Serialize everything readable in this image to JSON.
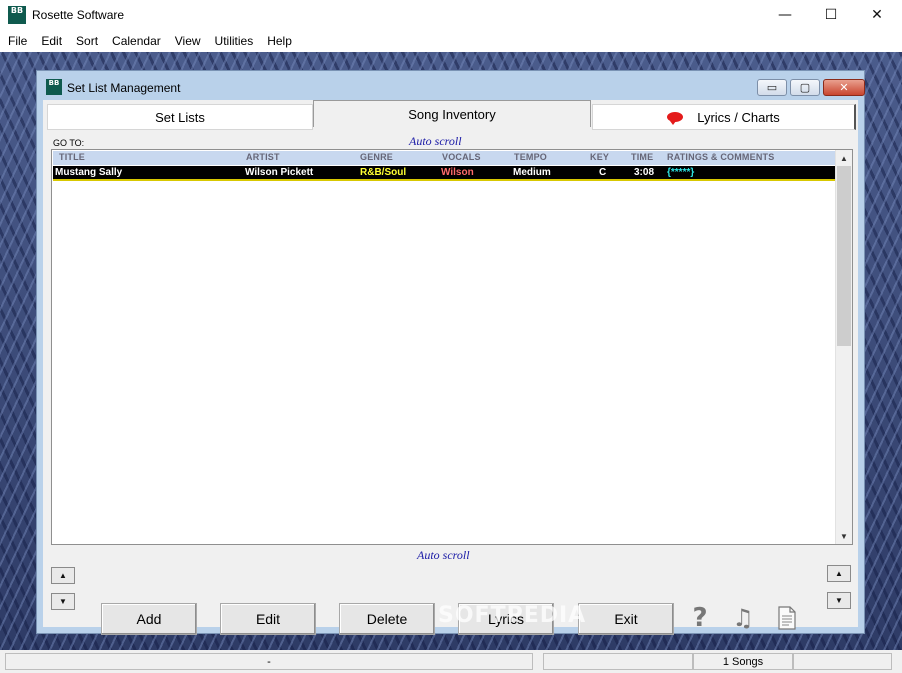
{
  "app": {
    "logo_text": "BB",
    "title": "Rosette Software",
    "controls": {
      "minimize": "—",
      "maximize": "☐",
      "close": "✕"
    }
  },
  "menu": [
    "File",
    "Edit",
    "Sort",
    "Calendar",
    "View",
    "Utilities",
    "Help"
  ],
  "dialog": {
    "title": "Set List Management",
    "controls": {
      "minimize": "▭",
      "maximize": "▢",
      "close": "✕"
    },
    "tabs": [
      {
        "label": "Set Lists",
        "active": false
      },
      {
        "label": "Song Inventory",
        "active": true
      },
      {
        "label": "Lyrics / Charts",
        "active": false,
        "icon": "speech-bubble-icon"
      }
    ],
    "goto_label": "GO TO:",
    "autoscroll_top": "Auto scroll",
    "autoscroll_bottom": "Auto scroll",
    "columns": [
      "TITLE",
      "ARTIST",
      "GENRE",
      "VOCALS",
      "TEMPO",
      "KEY",
      "TIME",
      "RATINGS & COMMENTS"
    ],
    "rows": [
      {
        "title": "Mustang Sally",
        "artist": "Wilson Pickett",
        "genre": "R&B/Soul",
        "vocals": "Wilson",
        "tempo": "Medium",
        "key": "C",
        "time": "3:08",
        "rating": "{*****}"
      }
    ],
    "colors": {
      "genre": "#ffff33",
      "vocals": "#ff6b6b",
      "rating": "#2ee6e6",
      "row_bg": "#000000",
      "row_border": "#d8c800"
    },
    "buttons": {
      "add": "Add",
      "edit": "Edit",
      "delete": "Delete",
      "lyrics": "Lyrics",
      "exit": "Exit"
    },
    "icons": {
      "help": "?",
      "music": "♫"
    },
    "watermark": "SOFTPEDIA"
  },
  "status": {
    "panel1": "-",
    "panel2": "",
    "panel3": "1 Songs",
    "panel4": ""
  }
}
